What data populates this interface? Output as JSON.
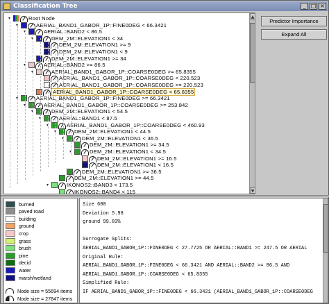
{
  "window": {
    "title": "Classification Tree"
  },
  "tree": [
    {
      "label": "Root Node",
      "level": 0,
      "twist": "−",
      "kind": "root"
    },
    {
      "label": "AERIAL_BAND1_GABOR_1P::FINE0DEG < 66.3421",
      "level": 1,
      "twist": "−",
      "blocks": [
        "#1a1ab8"
      ]
    },
    {
      "label": "AERIAL::BAND2 < 86.5",
      "level": 2,
      "twist": "−",
      "blocks": [
        "#1a1ab8"
      ]
    },
    {
      "label": "DEM_2M::ELEVATION1 < 34",
      "level": 3,
      "twist": "−",
      "blocks": [
        "#1a1ab8"
      ]
    },
    {
      "label": "DEM_2M::ELEVATION1 >= 9",
      "level": 4,
      "twist": "",
      "blocks": [
        "#101080"
      ]
    },
    {
      "label": "DEM_2M::ELEVATION1 < 9",
      "level": 4,
      "twist": "",
      "blocks": [
        "#101080"
      ]
    },
    {
      "label": "DEM_2M::ELEVATION1 >= 34",
      "level": 3,
      "twist": "",
      "blocks": [
        "#1a1ab8"
      ]
    },
    {
      "label": "AERIAL::BAND2 >= 86.5",
      "level": 2,
      "twist": "−",
      "blocks": [
        "#f6c7c9"
      ]
    },
    {
      "label": "AERIAL_BAND1_GABOR_1P::COARSE0DEG >= 65.8355",
      "level": 3,
      "twist": "−",
      "blocks": [
        "#f6c7c9"
      ]
    },
    {
      "label": "AERIAL_BAND1_GABOR_1P::COARSE0DEG < 220.523",
      "level": 4,
      "twist": "",
      "blocks": [
        "#f6c7c9"
      ]
    },
    {
      "label": "AERIAL_BAND1_GABOR_1P::COARSE0DEG >= 220.523",
      "level": 4,
      "twist": "",
      "blocks": [
        "#ffffff"
      ]
    },
    {
      "label": "AERIAL_BAND1_GABOR_1P::COARSE0DEG < 65.8355",
      "level": 3,
      "twist": "",
      "blocks": [
        "#e87d4a"
      ],
      "selected": true
    },
    {
      "label": "AERIAL_BAND1_GABOR_1P::FINE0DEG >= 66.3421",
      "level": 1,
      "twist": "−",
      "blocks": [
        "#2b9b2b"
      ]
    },
    {
      "label": "AERIAL_BAND1_GABOR_1P::COARSE0DEG >= 253.842",
      "level": 2,
      "twist": "−",
      "blocks": [
        "#2b9b2b"
      ]
    },
    {
      "label": "DEM_2M::ELEVATION1 < 54.5",
      "level": 3,
      "twist": "−",
      "blocks": [
        "#2b9b2b"
      ]
    },
    {
      "label": "AERIAL::BAND1 < 87.5",
      "level": 4,
      "twist": "−",
      "blocks": [
        "#2b9b2b"
      ]
    },
    {
      "label": "AERIAL_BAND1_GABOR_1P::COARSE0DEG < 460.93",
      "level": 5,
      "twist": "−",
      "blocks": [
        "#2b9b2b"
      ]
    },
    {
      "label": "DEM_2M::ELEVATION1 < 44.5",
      "level": 6,
      "twist": "−",
      "blocks": [
        "#2b9b2b"
      ]
    },
    {
      "label": "DEM_2M::ELEVATION1 < 36.5",
      "level": 7,
      "twist": "−",
      "blocks": [
        "#2b9b2b"
      ]
    },
    {
      "label": "DEM_2M::ELEVATION1 >= 34.5",
      "level": 8,
      "twist": "",
      "blocks": [
        "#2b9b2b"
      ]
    },
    {
      "label": "DEM_2M::ELEVATION1 < 34.5",
      "level": 8,
      "twist": "−",
      "blocks": [
        "#2b9b2b"
      ]
    },
    {
      "label": "DEM_2M::ELEVATION1 >= 16.5",
      "level": 9,
      "twist": "",
      "blocks": [
        "#f6c7c9"
      ]
    },
    {
      "label": "DEM_2M::ELEVATION1 < 16.5",
      "level": 9,
      "twist": "",
      "blocks": [
        "#101080"
      ]
    },
    {
      "label": "DEM_2M::ELEVATION1 >= 36.5",
      "level": 7,
      "twist": "",
      "blocks": [
        "#2b9b2b"
      ]
    },
    {
      "label": "DEM_2M::ELEVATION1 >= 44.5",
      "level": 6,
      "twist": "",
      "blocks": [
        "#2b9b2b"
      ]
    },
    {
      "label": "IKONOS2::BAND3 < 173.5",
      "level": 5,
      "twist": "−",
      "blocks": [
        "#7fe07f"
      ]
    },
    {
      "label": "IKONOS2::BAND4 < 115",
      "level": 6,
      "twist": "",
      "blocks": [
        "#7fe07f"
      ]
    }
  ],
  "buttons": {
    "predictor": "Predictor Importance",
    "expand": "Expand All"
  },
  "legend": {
    "items": [
      {
        "label": "burned",
        "color": "#2f4f4f"
      },
      {
        "label": "paved road",
        "color": "#8d8d8d"
      },
      {
        "label": "building",
        "color": "#ffffff"
      },
      {
        "label": "ground",
        "color": "#f0a36a"
      },
      {
        "label": "crop",
        "color": "#f6c7c9"
      },
      {
        "label": "grass",
        "color": "#d6f071"
      },
      {
        "label": "brush",
        "color": "#7fe07f"
      },
      {
        "label": "pine",
        "color": "#2b9b2b"
      },
      {
        "label": "decid",
        "color": "#0f6e0f"
      },
      {
        "label": "water",
        "color": "#1a1ab8"
      },
      {
        "label": "marsh/wetland",
        "color": "#101080"
      }
    ],
    "node_size_1": "Node size = 55694 items",
    "node_size_2": "Node size = 27847 items"
  },
  "info": {
    "lines": [
      "Size 600",
      "Deviation 5.98",
      "  ground 99.83%",
      "",
      "Surrogate Splits:",
      "  AERIAL_BAND1_GABOR_1P::FINE0DEG < 27.7725 OR AERIAL::BAND1 >= 247.5 OR AERIAL",
      "Original Rule:",
      "  AERIAL_BAND1_GABOR_1P::FINE0DEG < 66.3421 AND AERIAL::BAND2 >= 86.5 AND",
      "  AERIAL_BAND1_GABOR_1P::COARSE0DEG < 65.8355",
      "Simplified Rule:",
      "  IF AERIAL_BAND1_GABOR_1P::FINE0DEG < 66.3421 (AERIAL_BAND1_GABOR_1P::COARSE0DEG"
    ]
  }
}
